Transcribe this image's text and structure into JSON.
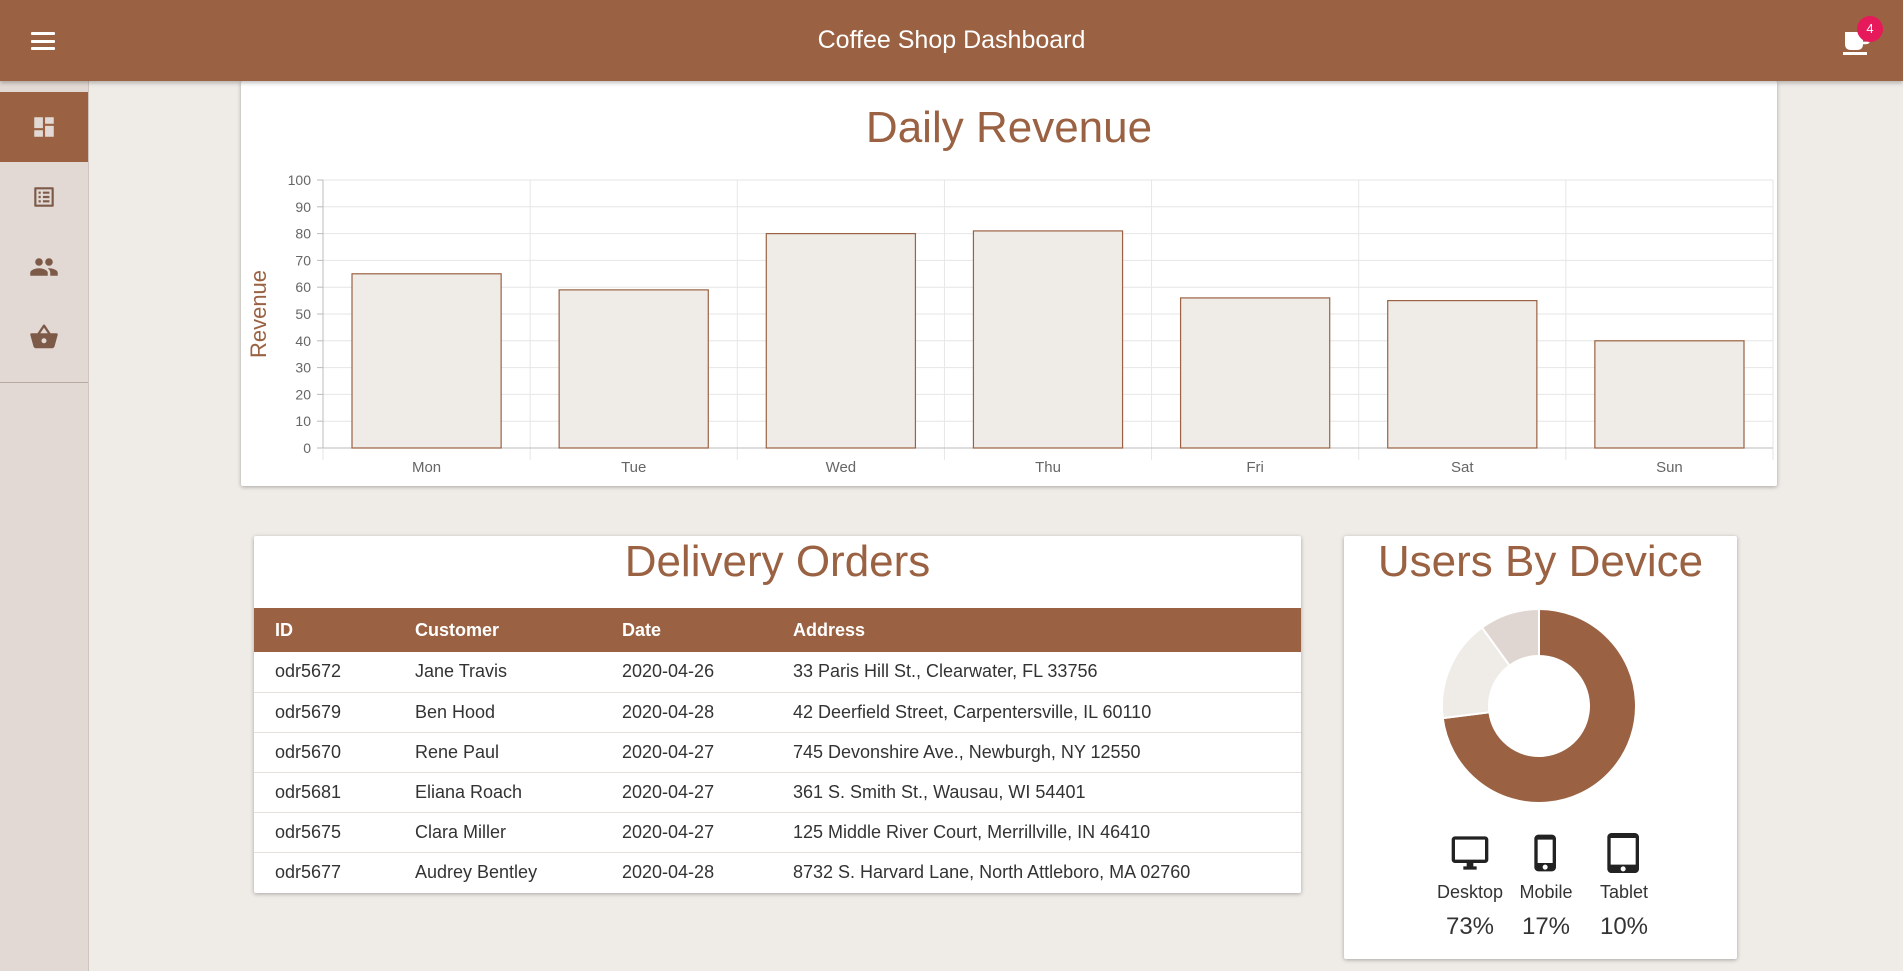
{
  "header": {
    "title": "Coffee Shop Dashboard",
    "cart_badge": "4",
    "accent": "#9a6242"
  },
  "sidebar": {
    "items": [
      {
        "icon": "dashboard-icon",
        "active": true
      },
      {
        "icon": "orders-list-icon",
        "active": false
      },
      {
        "icon": "users-icon",
        "active": false
      },
      {
        "icon": "basket-icon",
        "active": false
      }
    ]
  },
  "revenue": {
    "title": "Daily Revenue"
  },
  "orders": {
    "title": "Delivery Orders",
    "columns": [
      "ID",
      "Customer",
      "Date",
      "Address"
    ],
    "rows": [
      [
        "odr5672",
        "Jane Travis",
        "2020-04-26",
        "33 Paris Hill St., Clearwater, FL 33756"
      ],
      [
        "odr5679",
        "Ben Hood",
        "2020-04-28",
        "42 Deerfield Street, Carpentersville, IL 60110"
      ],
      [
        "odr5670",
        "Rene Paul",
        "2020-04-27",
        "745 Devonshire Ave., Newburgh, NY 12550"
      ],
      [
        "odr5681",
        "Eliana Roach",
        "2020-04-27",
        "361 S. Smith St., Wausau, WI 54401"
      ],
      [
        "odr5675",
        "Clara Miller",
        "2020-04-27",
        "125 Middle River Court, Merrillville, IN 46410"
      ],
      [
        "odr5677",
        "Audrey Bentley",
        "2020-04-28",
        "8732 S. Harvard Lane, North Attleboro, MA 02760"
      ]
    ]
  },
  "devices": {
    "title": "Users By Device",
    "items": [
      {
        "label": "Desktop",
        "percent": "73%",
        "icon": "desktop-icon"
      },
      {
        "label": "Mobile",
        "percent": "17%",
        "icon": "mobile-icon"
      },
      {
        "label": "Tablet",
        "percent": "10%",
        "icon": "tablet-icon"
      }
    ]
  },
  "chart_data": [
    {
      "type": "bar",
      "title": "Daily Revenue",
      "xlabel": "",
      "ylabel": "Revenue",
      "categories": [
        "Mon",
        "Tue",
        "Wed",
        "Thu",
        "Fri",
        "Sat",
        "Sun"
      ],
      "values": [
        65,
        59,
        80,
        81,
        56,
        55,
        40
      ],
      "ylim": [
        0,
        100
      ],
      "yticks": [
        0,
        10,
        20,
        30,
        40,
        50,
        60,
        70,
        80,
        90,
        100
      ],
      "grid": true,
      "bar_fill": "#efebe7",
      "bar_stroke": "#9a6242"
    },
    {
      "type": "pie",
      "title": "Users By Device",
      "labels": [
        "Desktop",
        "Mobile",
        "Tablet"
      ],
      "values": [
        73,
        17,
        10
      ],
      "colors": [
        "#9a6242",
        "#efebe7",
        "#e0d6d1"
      ]
    }
  ]
}
